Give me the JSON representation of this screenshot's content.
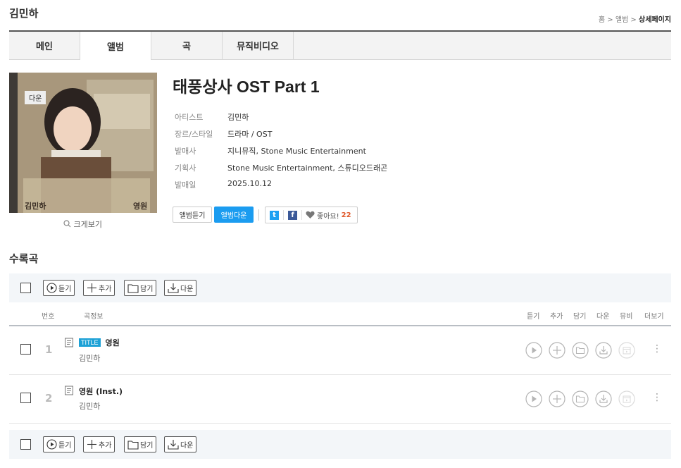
{
  "artist": "김민하",
  "breadcrumb": {
    "home": "홈",
    "sep1": ">",
    "album": "앨범",
    "sep2": ">",
    "current": "상세페이지"
  },
  "tabs": [
    {
      "label": "메인"
    },
    {
      "label": "앨범"
    },
    {
      "label": "곡"
    },
    {
      "label": "뮤직비디오"
    }
  ],
  "cover": {
    "badge": "다운",
    "artist_text": "김민하",
    "song_text": "영원"
  },
  "enlarge_label": "크게보기",
  "album": {
    "title": "태풍상사 OST Part 1",
    "meta": [
      {
        "key": "아티스트",
        "value": "김민하"
      },
      {
        "key": "장르/스타일",
        "value": "드라마 / OST"
      },
      {
        "key": "발매사",
        "value": "지니뮤직, Stone Music Entertainment"
      },
      {
        "key": "기획사",
        "value": "Stone Music Entertainment, 스튜디오드래곤"
      },
      {
        "key": "발매일",
        "value": "2025.10.12"
      }
    ],
    "listen_label": "앨범듣기",
    "download_label": "앨범다운",
    "twitter": "t",
    "facebook": "f",
    "like_label": "좋아요!",
    "like_count": "22"
  },
  "tracks_heading": "수록곡",
  "toolbar": {
    "listen": "듣기",
    "add": "추가",
    "put": "담기",
    "down": "다운"
  },
  "columns": {
    "no": "번호",
    "info": "곡정보",
    "listen": "듣기",
    "add": "추가",
    "put": "담기",
    "down": "다운",
    "mv": "뮤비",
    "more": "더보기"
  },
  "tracks": [
    {
      "no": "1",
      "badge": "TITLE",
      "title": "영원",
      "artist": "김민하"
    },
    {
      "no": "2",
      "badge": "",
      "title": "영원 (Inst.)",
      "artist": "김민하"
    }
  ],
  "colors": {
    "accent": "#1b9cf0",
    "title_badge": "#1da1d6",
    "like_count": "#e05a2c",
    "twitter": "#1da1f2",
    "facebook": "#3b5998"
  }
}
